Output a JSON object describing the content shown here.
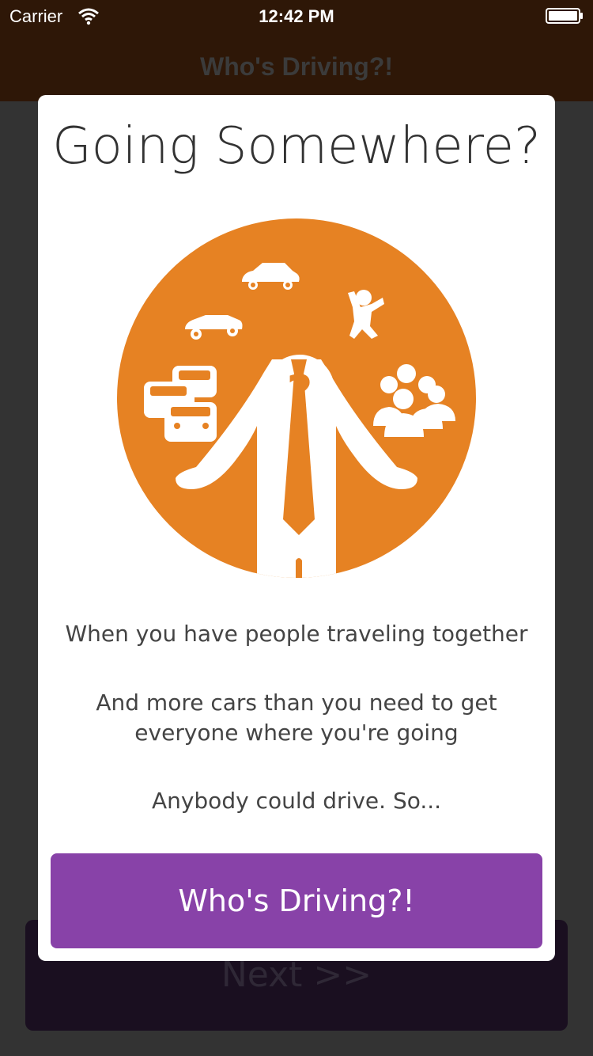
{
  "status_bar": {
    "carrier": "Carrier",
    "time": "12:42 PM"
  },
  "nav": {
    "title": "Who's Driving?!"
  },
  "background": {
    "next_label": "Next >>"
  },
  "dialog": {
    "title": "Going Somewhere?",
    "line1": "When you have people traveling together",
    "line2": "And more cars than you need to get everyone where you're going",
    "line3": "Anybody could drive. So...",
    "button_label": "Who's Driving?!",
    "question_mark": "?"
  },
  "colors": {
    "accent_orange": "#e68223",
    "button_purple": "#8842a8",
    "nav_brown": "#2e1707"
  }
}
